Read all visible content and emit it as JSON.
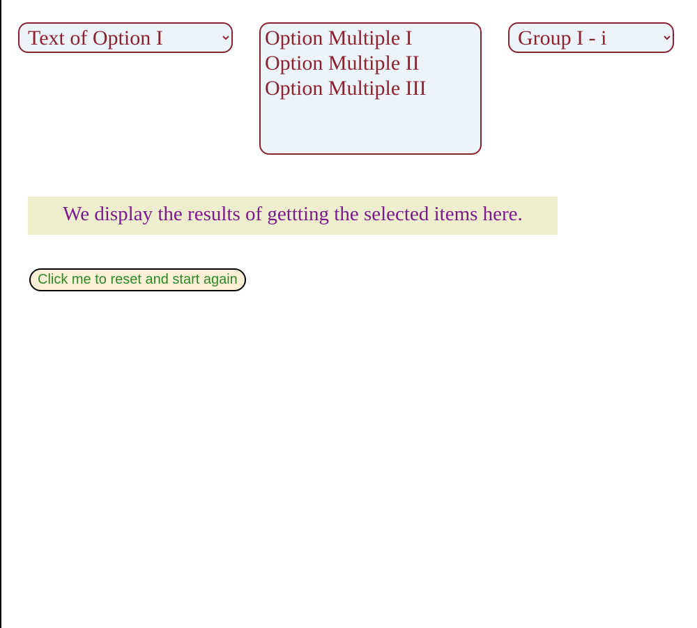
{
  "selects": {
    "option_single": {
      "selected": "Text of Option I"
    },
    "option_multiple": {
      "options": [
        "Option Multiple I",
        "Option Multiple II",
        "Option Multiple III"
      ]
    },
    "option_group": {
      "selected": "Group I - i"
    }
  },
  "results": {
    "text": "We display the results of gettting the selected items here."
  },
  "reset_button": {
    "label": "Click me to reset and start again"
  },
  "colors": {
    "select_border": "#8b2230",
    "select_bg": "#ecf3f9",
    "select_text": "#8b2230",
    "banner_bg": "#eeeecf",
    "banner_text": "#7a1a8c",
    "button_bg": "#fcf1d6",
    "button_text": "#2e8727",
    "button_border": "#000000"
  }
}
